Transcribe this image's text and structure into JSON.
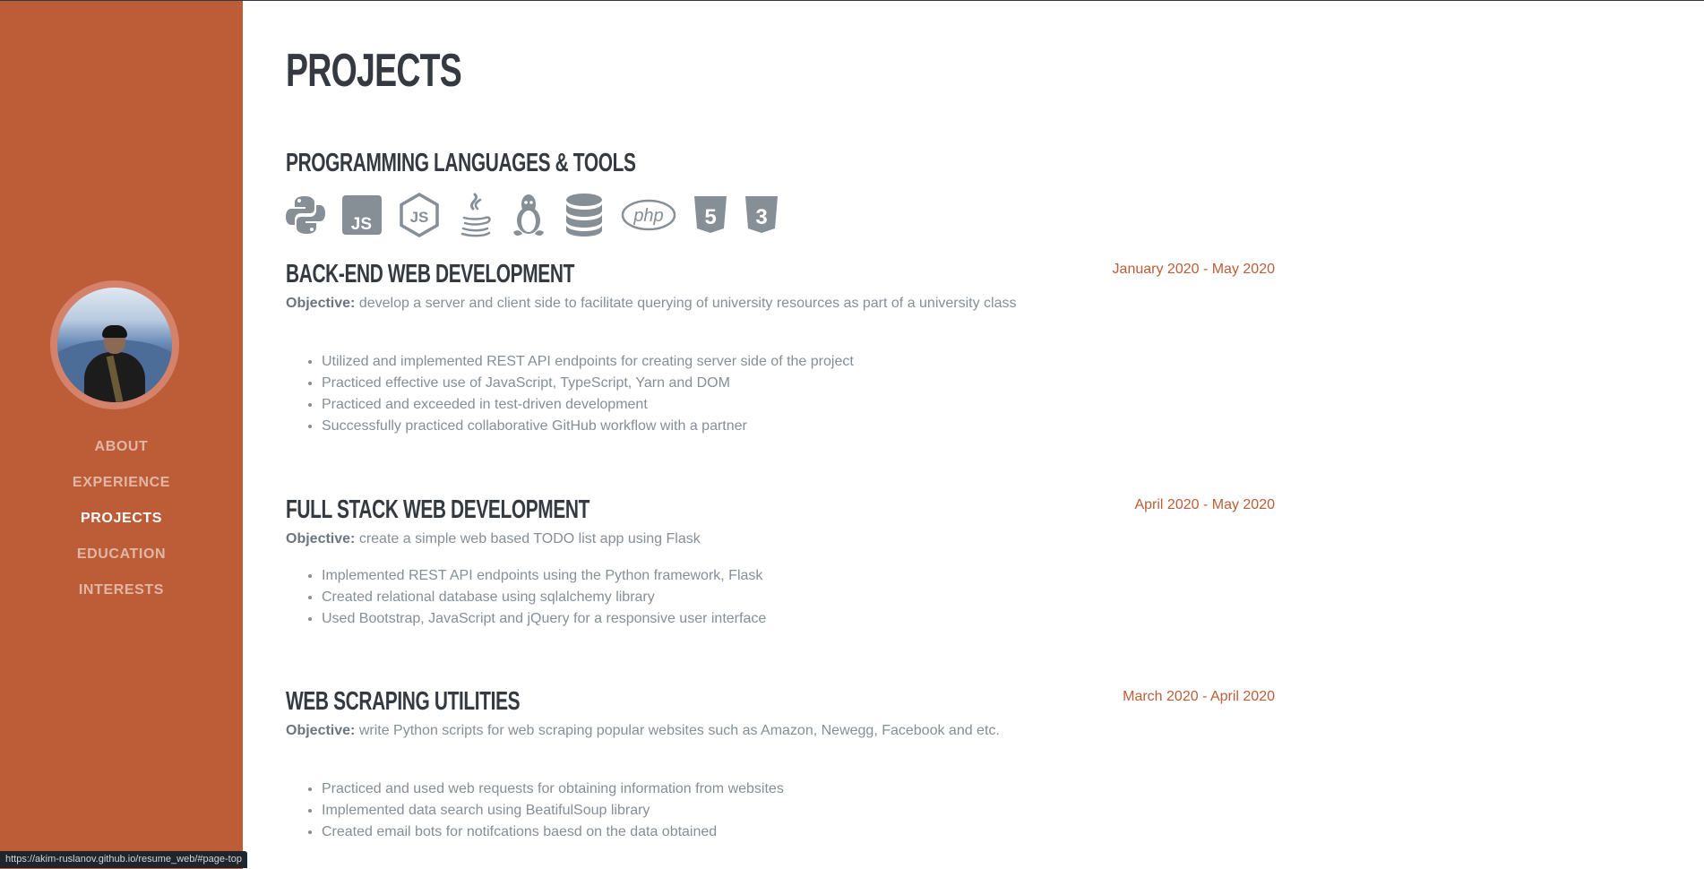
{
  "sidebar": {
    "accent": "#bd5d38",
    "avatar_alt": "profile photo",
    "nav": [
      {
        "label": "ABOUT",
        "active": false
      },
      {
        "label": "EXPERIENCE",
        "active": false
      },
      {
        "label": "PROJECTS",
        "active": true
      },
      {
        "label": "EDUCATION",
        "active": false
      },
      {
        "label": "INTERESTS",
        "active": false
      }
    ]
  },
  "main": {
    "title": "PROJECTS",
    "skills_title": "PROGRAMMING LANGUAGES & TOOLS",
    "skill_icons": [
      "python-icon",
      "js-square-icon",
      "nodejs-icon",
      "java-icon",
      "linux-icon",
      "database-icon",
      "php-icon",
      "html5-icon",
      "css3-icon"
    ],
    "objective_label": "Objective:",
    "projects": [
      {
        "title": "BACK-END WEB DEVELOPMENT",
        "date": "January 2020 - May 2020",
        "objective": "develop a server and client side to facilitate querying of university resources as part of a university class",
        "bullets": [
          "Utilized and implemented REST API endpoints for creating server side of the project",
          "Practiced effective use of JavaScript, TypeScript, Yarn and DOM",
          "Practiced and exceeded in test-driven development",
          "Successfully practiced collaborative GitHub workflow with a partner"
        ]
      },
      {
        "title": "FULL STACK WEB DEVELOPMENT",
        "date": "April 2020 - May 2020",
        "objective": "create a simple web based TODO list app using Flask",
        "bullets": [
          "Implemented REST API endpoints using the Python framework, Flask",
          "Created relational database using sqlalchemy library",
          "Used Bootstrap, JavaScript and jQuery for a responsive user interface"
        ]
      },
      {
        "title": "WEB SCRAPING UTILITIES",
        "date": "March 2020 - April 2020",
        "objective": "write Python scripts for web scraping popular websites such as Amazon, Newegg, Facebook and etc.",
        "bullets": [
          "Practiced and used web requests for obtaining information from websites",
          "Implemented data search using BeatifulSoup library",
          "Created email bots for notifcations baesd on the data obtained"
        ]
      }
    ]
  },
  "status_bar": {
    "url": "https://akim-ruslanov.github.io/resume_web/#page-top"
  }
}
